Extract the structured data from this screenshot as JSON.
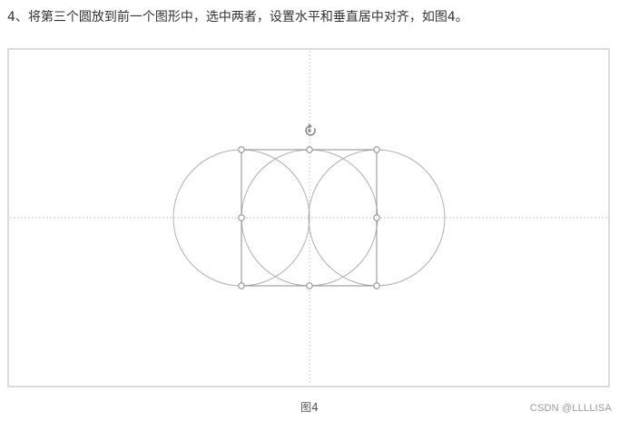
{
  "article": {
    "step_text": "4、将第三个圆放到前一个图形中，选中两者，设置水平和垂直居中对齐，如图4。",
    "caption": "图4",
    "watermark": "CSDN @LLLLISA"
  },
  "figure": {
    "shapes": [
      "circle-left",
      "circle-middle",
      "circle-right"
    ],
    "selection_handles": 8,
    "rotate_icon": "rotate-handle-icon",
    "colors": {
      "circle_stroke": "#b0b0b0",
      "selection_stroke": "#8c8c8c",
      "guide_line": "#c8c8c8",
      "frame_border": "#dcdcdc"
    }
  }
}
